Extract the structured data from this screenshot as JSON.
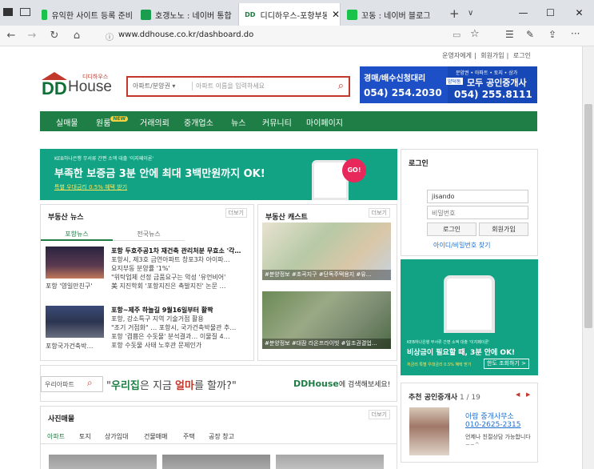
{
  "browser": {
    "tabs": [
      {
        "label": "유익한 사이트 등록 준비"
      },
      {
        "label": "호갱노노 : 네이버 통합"
      },
      {
        "label": "디디하우스-포항부동"
      },
      {
        "label": "꼬동 : 네이버 블로그"
      }
    ],
    "url": "www.ddhouse.co.kr/dashboard.do",
    "new_tab": "+",
    "tab_menu": "∨"
  },
  "header": {
    "top_links": [
      "운영자에게",
      "회원가입",
      "로그인"
    ],
    "logo_small": "디디하우스",
    "logo_dd": "DD",
    "logo_house": "House",
    "search_category": "아파트/분양권 ▾",
    "search_placeholder": "아파트 이름을 입력하세요"
  },
  "ad": {
    "left_title": "경매/배수신청대리",
    "left_phone": "054) 254.2030",
    "right_sub": "분양권 • 아파트 • 토지 • 상가",
    "right_badge": "양덕동",
    "right_title": "모두 공인중개사",
    "right_phone": "054) 255.8111"
  },
  "nav": {
    "items": [
      "실매물",
      "원룸",
      "거래의뢰",
      "중개업소",
      "뉴스",
      "커뮤니티",
      "마이페이지"
    ],
    "new_badge": "NEW"
  },
  "banner": {
    "small": "KEB하나은행 무서류 간편 소액 대출 '이지페이론'",
    "main": "부족한 보증금 3분 안에 최대 3백만원까지 OK!",
    "sub": "특별 우대금리 0.5% 혜택 받기",
    "go": "GO!"
  },
  "news": {
    "title": "부동산 뉴스",
    "more": "더보기",
    "tabs": [
      "포항뉴스",
      "전국뉴스"
    ],
    "items": [
      {
        "caption": "포항 '영일만친구'",
        "headline": "포항 두호주공1차 재건축 관리처분 무효소 '각…",
        "lines": [
          "포항시, 제3호 금연아파트 창포3차 아이파…",
          "요지부동 분양률 '1%'",
          "\"위탁업체 선정 금품요구는 악성 '유언비어'",
          "美 지진학회 '포항지진은 촉발지진' 논문 …"
        ]
      },
      {
        "caption": "포항국가건축박…",
        "headline": "포항~제주 하늘길 9월16일부터 활짝",
        "lines": [
          "포항, 강소특구 지역 기술거점 활용",
          "\"조기 거점화\" … 포항시, 국가건축박물관 추…",
          "포항 '겹쁨은 수돗물' 분석결과… 이물질 4…",
          "포항 수돗물 사태 노후관 문제인가"
        ]
      }
    ]
  },
  "cast": {
    "title": "부동산 캐스트",
    "more": "더보기",
    "items": [
      {
        "caption": "#분양정보 #초곡지구 #단독주택용지 #유…"
      },
      {
        "caption": "#분양정보 #대잠 라온프라이빗 #일조권결업…"
      }
    ]
  },
  "login": {
    "title": "로그인",
    "id_value": "jisando",
    "pw_placeholder": "비밀번호",
    "login_btn": "로그인",
    "join_btn": "회원가입",
    "find_link": "아이디/비밀번호 찾기"
  },
  "side_ad": {
    "small": "KEB하나은행 무서류 간편 소액 대출 '이지페이론'",
    "main": "비상금이 필요할 때, 3분 안에 OK!",
    "sub": "저금리 특별 우대금리 0.5% 혜택 받기",
    "btn": "한도 조회하기 >"
  },
  "search_banner": {
    "input": "우리아파트",
    "slogan_pre": "\"",
    "slogan_a": "우리집",
    "slogan_b": "은 지금 ",
    "slogan_c": "얼마",
    "slogan_d": "를 할까?\"",
    "dd": "DD",
    "house": "House",
    "tail": "에 검색해보세요!"
  },
  "photo": {
    "title": "사진매물",
    "more": "더보기",
    "tabs": [
      "아파트",
      "토지",
      "상가임대",
      "건물매매",
      "주택",
      "공장 창고"
    ]
  },
  "agent": {
    "title": "추천 공인중개사",
    "count": "1 / 19",
    "name": "아람 중개사무소",
    "phone": "010-2625-2315",
    "desc": "언제나 친절상담 가능합니다",
    "extra": "~~^"
  },
  "colors": {
    "brand_green": "#1f7e45",
    "brand_red": "#c0392b",
    "ad_blue": "#1748b8",
    "banner_teal": "#12a384"
  }
}
